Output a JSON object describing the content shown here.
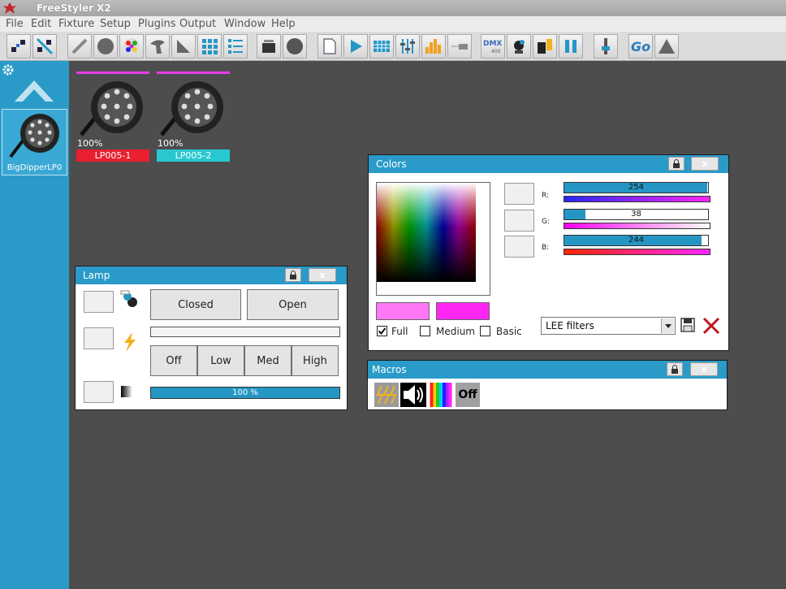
{
  "app": {
    "title": "FreeStyler X2"
  },
  "menu": [
    "File",
    "Edit",
    "Fixture",
    "Setup",
    "Plugins",
    "Output",
    "Window",
    "Help"
  ],
  "toolbar": {
    "dmx_label": "DMX",
    "dmx_sub": "400",
    "go_label": "Go"
  },
  "sidebar": {
    "fixture_label": "BigDipperLP0"
  },
  "fixtures": [
    {
      "name": "LP005-1",
      "level": "100%",
      "color": "#e8202f"
    },
    {
      "name": "LP005-2",
      "level": "100%",
      "color": "#29c8d0"
    }
  ],
  "lamp": {
    "title": "Lamp",
    "close": "x",
    "closed": "Closed",
    "open": "Open",
    "off": "Off",
    "low": "Low",
    "med": "Med",
    "high": "High",
    "dimmer": "100 %",
    "dimmer_value": 1.0
  },
  "colors": {
    "title": "Colors",
    "close": "x",
    "r_label": "R:",
    "g_label": "G:",
    "b_label": "B:",
    "r": 254,
    "g": 38,
    "b": 244,
    "full": "Full",
    "medium": "Medium",
    "basic": "Basic",
    "filter": "LEE filters",
    "swatch1": "#ff77f5",
    "swatch2": "#ff26f4"
  },
  "macros": {
    "title": "Macros",
    "close": "x",
    "off_label": "Off"
  },
  "accent": "#2a9bc9"
}
